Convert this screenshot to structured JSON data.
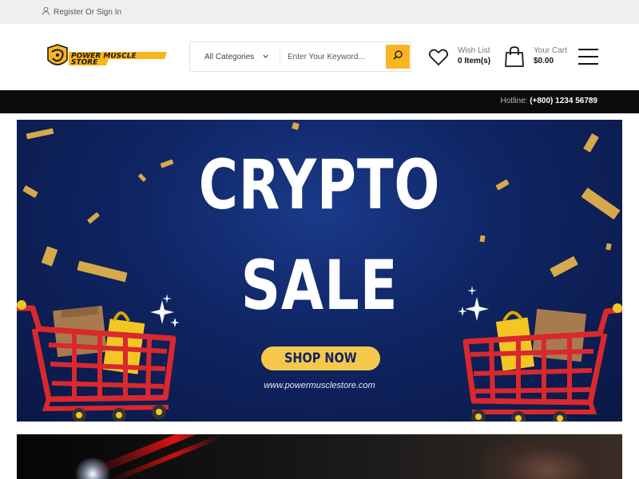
{
  "topbar": {
    "auth_text": "Register Or Sign In"
  },
  "header": {
    "logo_text_line1": "POWER MUSCLE",
    "logo_text_line2": "STORE",
    "search": {
      "category": "All Categories",
      "placeholder": "Enter Your Keyword..."
    },
    "wishlist": {
      "label": "Wish List",
      "value": "0 Item(s)"
    },
    "cart": {
      "label": "Your Cart",
      "value": "$0.00"
    }
  },
  "hotline": {
    "label": "Hotline:",
    "number": "(+800) 1234 56789"
  },
  "banner": {
    "title_line1": "CRYPTO",
    "title_line2": "SALE",
    "button": "SHOP NOW",
    "url": "www.powermusclestore.com"
  },
  "colors": {
    "accent": "#f9b51e",
    "banner_bg": "#0f2462",
    "hotline_bg": "#0c0c0c",
    "topbar_bg": "#efefef"
  },
  "icons": [
    "user-icon",
    "chevron-down-icon",
    "search-icon",
    "heart-icon",
    "shopping-bag-icon",
    "hamburger-menu-icon"
  ]
}
